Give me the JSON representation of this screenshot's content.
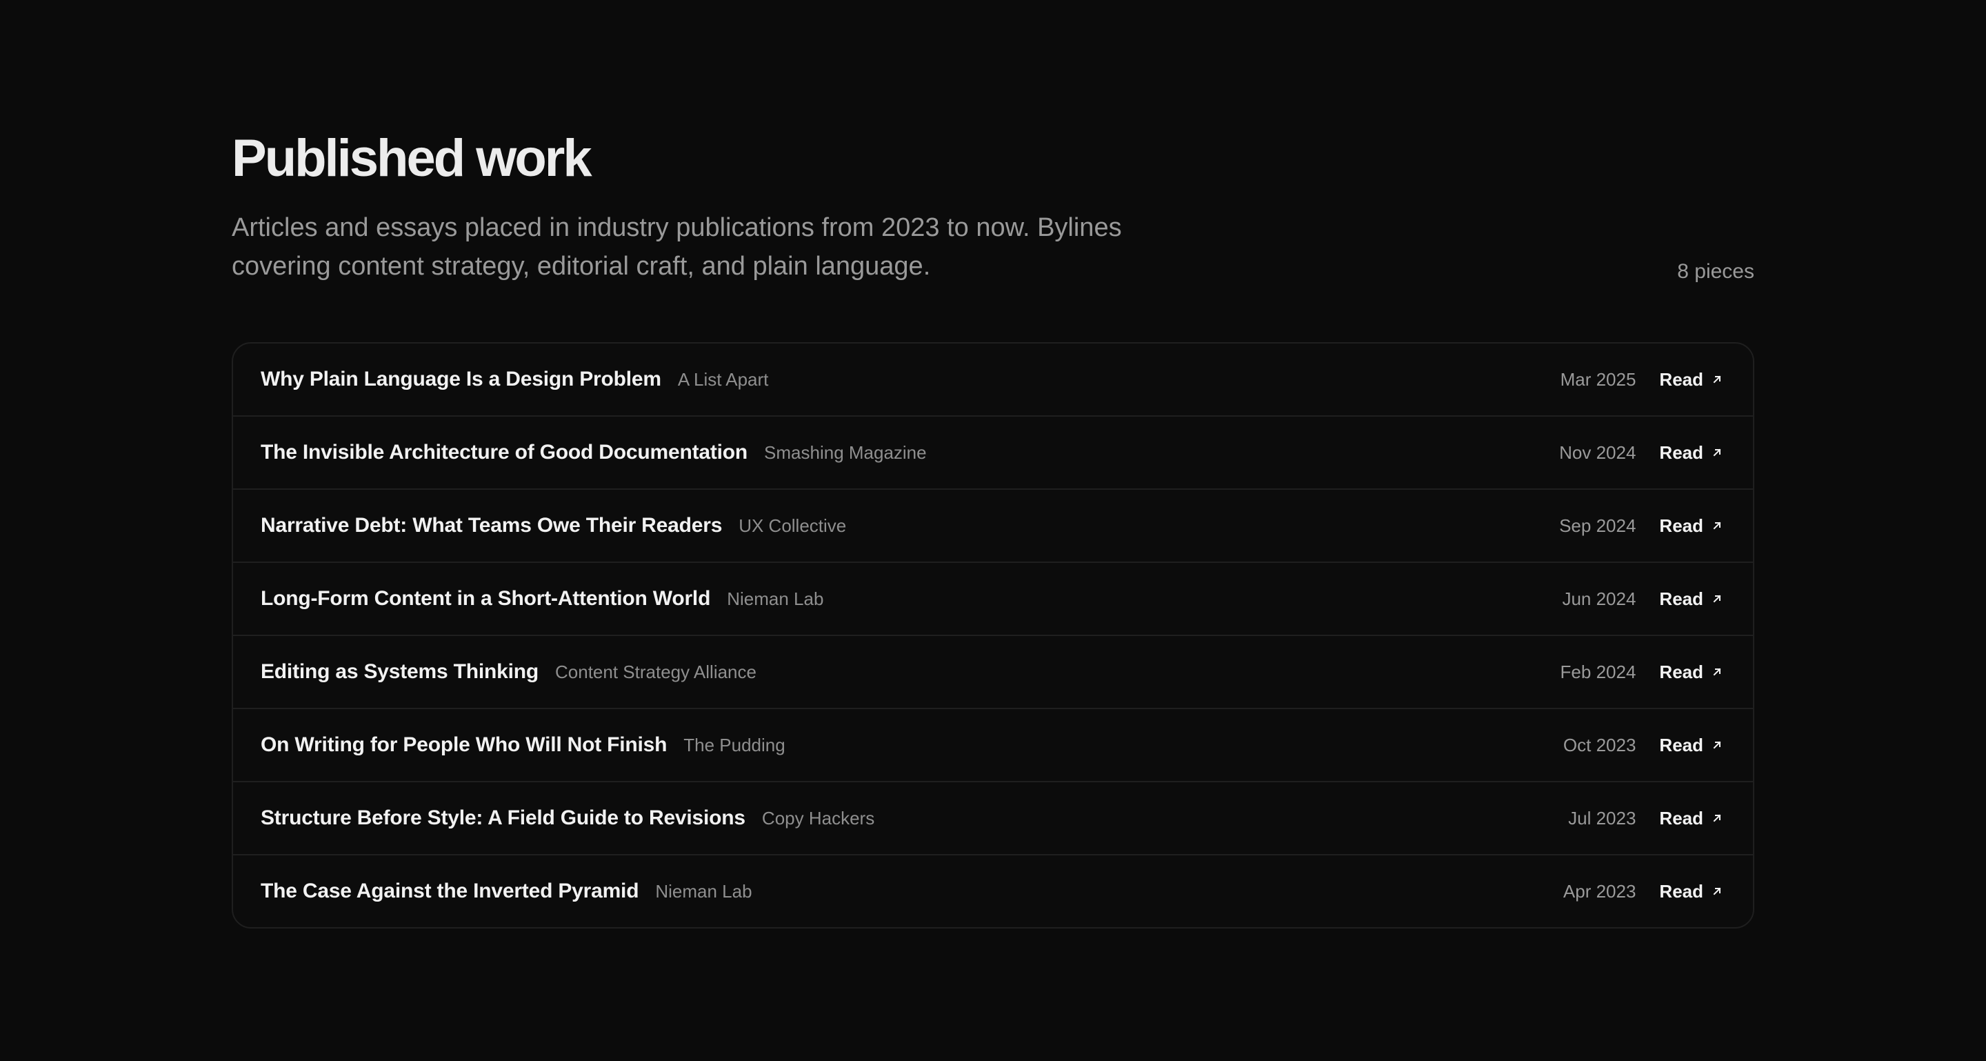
{
  "header": {
    "title": "Published work",
    "subtitle": "Articles and essays placed in industry publications from 2023 to now. Bylines covering content strategy, editorial craft, and plain language.",
    "count": "8 pieces"
  },
  "read_label": "Read",
  "icons": {
    "read_arrow": "arrow-up-right-icon"
  },
  "colors": {
    "background": "#0b0b0b",
    "title": "#ececec",
    "muted": "#9a9a9a",
    "border": "#1f1f1f"
  },
  "articles": [
    {
      "title": "Why Plain Language Is a Design Problem",
      "publication": "A List Apart",
      "date": "Mar 2025"
    },
    {
      "title": "The Invisible Architecture of Good Documentation",
      "publication": "Smashing Magazine",
      "date": "Nov 2024"
    },
    {
      "title": "Narrative Debt: What Teams Owe Their Readers",
      "publication": "UX Collective",
      "date": "Sep 2024"
    },
    {
      "title": "Long-Form Content in a Short-Attention World",
      "publication": "Nieman Lab",
      "date": "Jun 2024"
    },
    {
      "title": "Editing as Systems Thinking",
      "publication": "Content Strategy Alliance",
      "date": "Feb 2024"
    },
    {
      "title": "On Writing for People Who Will Not Finish",
      "publication": "The Pudding",
      "date": "Oct 2023"
    },
    {
      "title": "Structure Before Style: A Field Guide to Revisions",
      "publication": "Copy Hackers",
      "date": "Jul 2023"
    },
    {
      "title": "The Case Against the Inverted Pyramid",
      "publication": "Nieman Lab",
      "date": "Apr 2023"
    }
  ]
}
